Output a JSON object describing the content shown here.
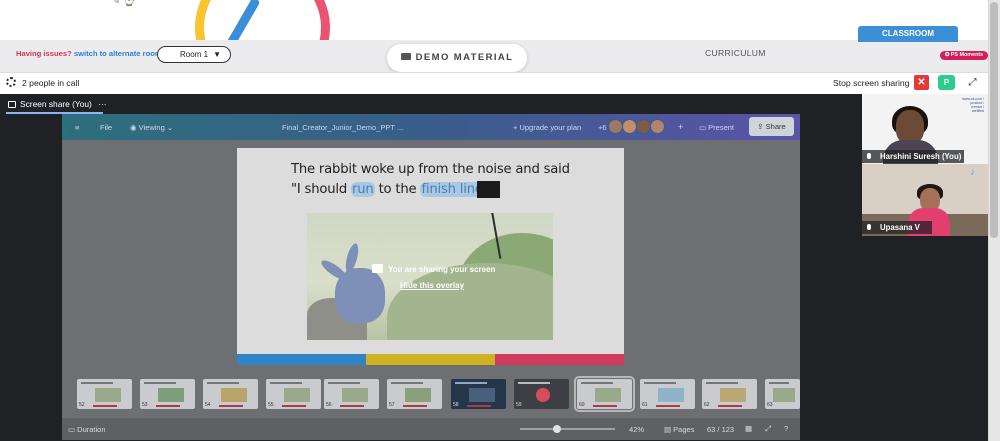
{
  "colors": {
    "accent": "#3a8fd6",
    "danger": "#e53935",
    "brand_pink": "#d21e5a",
    "dark": "#202124"
  },
  "header": {
    "issues_text": "Having issues?",
    "alt_room_link": "switch to alternate room",
    "room_select": "Room 1",
    "demo_tab": "DEMO MATERIAL",
    "curriculum_tab": "CURRICULUM",
    "classroom_tab": "CLASSROOM",
    "ps_badge": "PS Moments"
  },
  "callbar": {
    "people": "2 people in call",
    "stop_sharing": "Stop screen sharing",
    "participant_initial": "P"
  },
  "share": {
    "tab_label": "Screen share (You)",
    "more": "···"
  },
  "canva": {
    "menu": "≡",
    "file": "File",
    "viewing": "Viewing",
    "doc_title": "Final_Creator_Junior_Demo_PPT ...",
    "upgrade": "+ Upgrade your plan",
    "collab_count": "+6",
    "present": "Present",
    "share": "Share",
    "slide_line1": "The rabbit woke up from the noise and said",
    "slide_line2_a": "\"I should ",
    "slide_word1": "run",
    "slide_line2_b": " to the ",
    "slide_word2": "finish line",
    "slide_line2_c": "\"",
    "overlay_title": "You are sharing your screen",
    "overlay_link": "Hide this overlay",
    "duration": "Duration",
    "zoom": "42%",
    "pages": "Pages",
    "page_count": "63 / 123",
    "help": "?"
  },
  "thumbs": [
    {
      "num": "52"
    },
    {
      "num": "53"
    },
    {
      "num": "54"
    },
    {
      "num": "55"
    },
    {
      "num": "56"
    },
    {
      "num": "57"
    },
    {
      "num": "58"
    },
    {
      "num": "59"
    },
    {
      "num": "60"
    },
    {
      "num": "61"
    },
    {
      "num": "62"
    },
    {
      "num": "63"
    }
  ],
  "participants": [
    {
      "name": "Harshini Suresh (You)"
    },
    {
      "name": "Upasana V"
    }
  ],
  "tile_logo": "www.ok.com / product / mentor / certified"
}
